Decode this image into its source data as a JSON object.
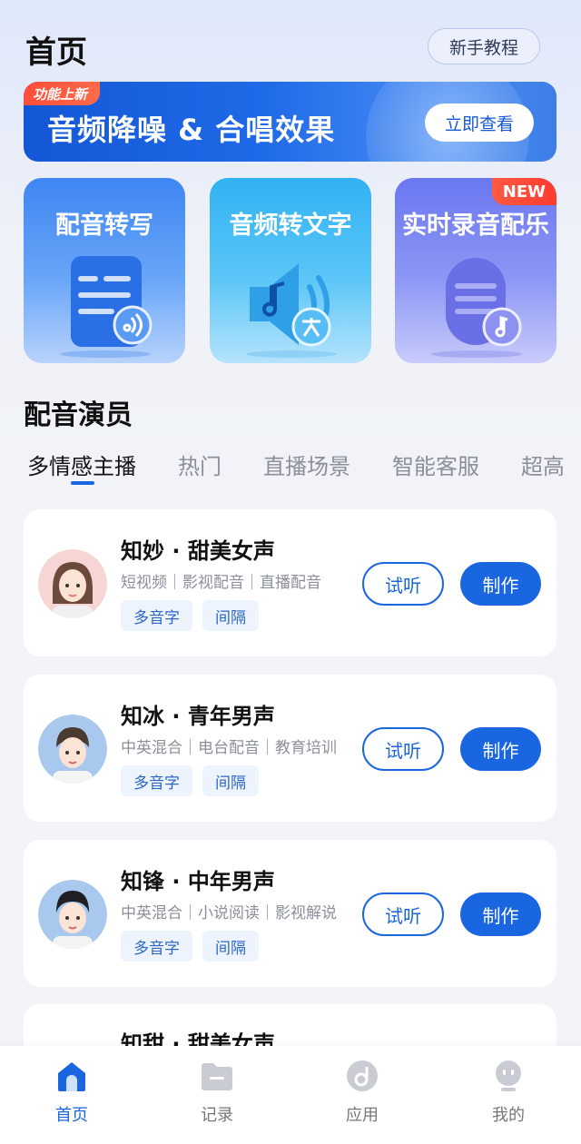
{
  "header": {
    "title": "首页",
    "tutorial_label": "新手教程"
  },
  "banner": {
    "badge": "功能上新",
    "text": "音频降噪 & 合唱效果",
    "button": "立即查看"
  },
  "features": [
    {
      "title": "配音转写",
      "badge": ""
    },
    {
      "title": "音频转文字",
      "badge": ""
    },
    {
      "title": "实时录音配乐",
      "badge": "NEW"
    }
  ],
  "section": {
    "title": "配音演员"
  },
  "tabs": [
    "多情感主播",
    "热门",
    "直播场景",
    "智能客服",
    "超高"
  ],
  "voices": [
    {
      "name": "知妙 · 甜美女声",
      "tags": "短视频｜影视配音｜直播配音",
      "chips": [
        "多音字",
        "间隔"
      ],
      "listen": "试听",
      "make": "制作"
    },
    {
      "name": "知冰 · 青年男声",
      "tags": "中英混合｜电台配音｜教育培训",
      "chips": [
        "多音字",
        "间隔"
      ],
      "listen": "试听",
      "make": "制作"
    },
    {
      "name": "知锋 · 中年男声",
      "tags": "中英混合｜小说阅读｜影视解说",
      "chips": [
        "多音字",
        "间隔"
      ],
      "listen": "试听",
      "make": "制作"
    },
    {
      "name": "知甜 · 甜美女声"
    }
  ],
  "nav": [
    {
      "label": "首页",
      "icon": "home-icon"
    },
    {
      "label": "记录",
      "icon": "folder-icon"
    },
    {
      "label": "应用",
      "icon": "music-disc-icon"
    },
    {
      "label": "我的",
      "icon": "profile-icon"
    }
  ],
  "colors": {
    "primary": "#1a66e0",
    "badge_red": "#ff3b30"
  }
}
